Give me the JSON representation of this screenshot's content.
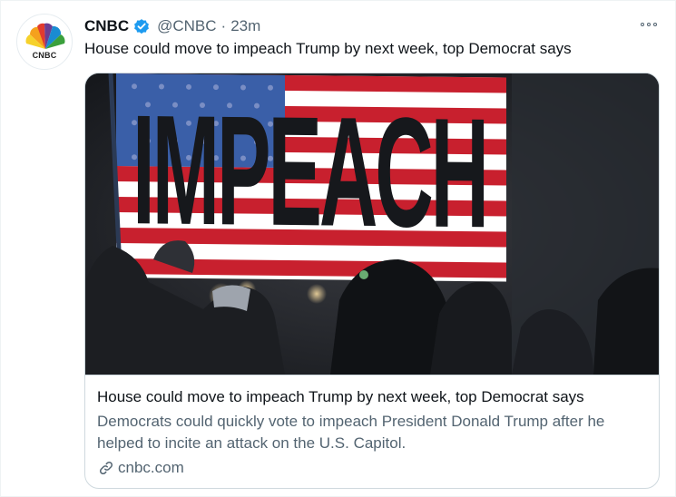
{
  "account": {
    "name": "CNBC",
    "handle": "@CNBC",
    "separator": "·",
    "time": "23m",
    "avatar_word": "CNBC",
    "verified_color": "#1d9bf0"
  },
  "tweet": {
    "text": "House could move to impeach Trump by next week, top Democrat says"
  },
  "card": {
    "image_flag_word": "IMPEACH",
    "title": "House could move to impeach Trump by next week, top Democrat says",
    "description": "Democrats could quickly vote to impeach President Donald Trump after he helped to incite an attack on the U.S. Capitol.",
    "domain": "cnbc.com",
    "link_icon": "link-icon"
  },
  "menu": {
    "icon": "more-options-icon"
  },
  "colors": {
    "text": "#0f1419",
    "secondary": "#536471",
    "border": "#cfd9de",
    "flag_red": "#c8202e",
    "flag_blue": "#3a5fa8"
  }
}
